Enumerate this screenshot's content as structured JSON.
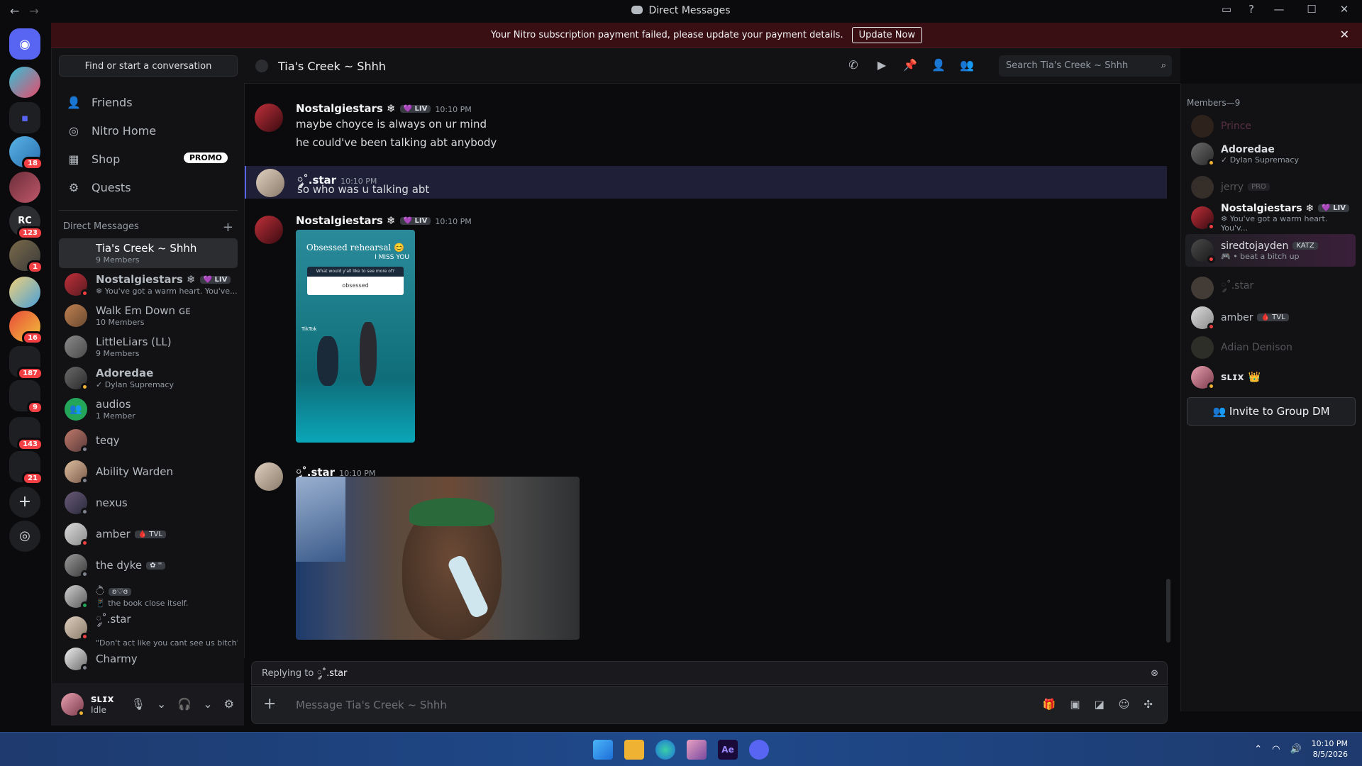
{
  "window": {
    "title": "Direct Messages"
  },
  "banner": {
    "text": "Your Nitro subscription payment failed, please update your payment details.",
    "button": "Update Now"
  },
  "guild_badges": [
    "18",
    "123",
    "1",
    "16",
    "187",
    "9",
    "143",
    "21"
  ],
  "dm_sidebar": {
    "find_placeholder": "Find or start a conversation",
    "nav": [
      {
        "label": "Friends",
        "icon": "friends-icon"
      },
      {
        "label": "Nitro Home",
        "icon": "nitro-icon"
      },
      {
        "label": "Shop",
        "icon": "shop-icon",
        "badge": "PROMO"
      },
      {
        "label": "Quests",
        "icon": "quests-icon"
      }
    ],
    "section_header": "Direct Messages",
    "items": [
      {
        "name": "Tia's Creek ~ Shhh",
        "sub": "9 Members",
        "selected": true
      },
      {
        "name": "Nostalgiestars ❄",
        "tag": "💜 LIV",
        "sub": "❄ You've got a warm heart. You've..."
      },
      {
        "name": "Walk Em Down ɢᴇ",
        "sub": "10 Members"
      },
      {
        "name": "LittleLiars (LL)",
        "sub": "9 Members"
      },
      {
        "name": "Adoredae",
        "sub": "✓ Dylan Supremacy"
      },
      {
        "name": "audios",
        "sub": "1 Member"
      },
      {
        "name": "teqy",
        "sub": ""
      },
      {
        "name": "Ability Warden",
        "sub": ""
      },
      {
        "name": "nexus",
        "sub": ""
      },
      {
        "name": "amber",
        "tag": "🩸 TVL",
        "sub": ""
      },
      {
        "name": "the dyke",
        "tag": "✿ '' ",
        "sub": ""
      },
      {
        "name": "ੈ",
        "tag": "ʚ♡ɞ",
        "sub": "📱 the book close itself."
      },
      {
        "name": "༘˚.star",
        "sub": "\"Don't act like you cant see us bitch\""
      },
      {
        "name": "Charmy",
        "sub": ""
      }
    ]
  },
  "user_panel": {
    "name": "ꜱʟɪx",
    "status": "Idle"
  },
  "chat": {
    "title": "Tia's Creek ~ Shhh",
    "search_placeholder": "Search Tia's Creek ~ Shhh",
    "messages": [
      {
        "author": "Nostalgiestars ❄",
        "tag": "💜 LIV",
        "time": "10:10 PM",
        "lines": [
          "maybe choyce is always on ur mind",
          "he could've been talking abt anybody"
        ]
      },
      {
        "author": "༘˚.star",
        "time": "10:10 PM",
        "lines": [
          "so who was u talking abt"
        ],
        "highlighted": true
      },
      {
        "author": "Nostalgiestars ❄",
        "tag": "💜 LIV",
        "time": "10:10 PM",
        "image": {
          "caption_top": "Obsessed rehearsal 😊",
          "caption_sub": "I MISS YOU",
          "question": "What would y'all like to see more of?",
          "answer": "obsessed",
          "watermark": "TikTok"
        }
      },
      {
        "author": "༘˚.star",
        "time": "10:10 PM",
        "image_kind": "gif"
      }
    ],
    "reply": {
      "prefix": "Replying to",
      "to": "༘˚.star"
    },
    "composer_placeholder": "Message Tia's Creek ~ Shhh"
  },
  "members": {
    "header": "Members—9",
    "items": [
      {
        "name": "Prince",
        "sub": "",
        "dim": true,
        "color": "#c25c8a"
      },
      {
        "name": "Adoredae",
        "sub": "✓ Dylan Supremacy"
      },
      {
        "name": "jerry",
        "tag": "PRO",
        "sub": "",
        "dim": true
      },
      {
        "name": "Nostalgiestars ❄",
        "tag": "💜 LIV",
        "sub": "❄ You've got a warm heart. You'v..."
      },
      {
        "name": "siredtojayden",
        "tag": "KATZ",
        "sub": "🎮 • beat a bitch up"
      },
      {
        "name": "༘˚.star",
        "sub": "",
        "dim": true
      },
      {
        "name": "amber",
        "tag": "🩸 TVL",
        "sub": ""
      },
      {
        "name": "Adian Denison",
        "sub": "",
        "dim": true
      },
      {
        "name": "ꜱʟɪx",
        "tag": "👑",
        "sub": ""
      }
    ],
    "invite_button": "Invite to Group DM"
  },
  "taskbar": {
    "time": "10:10 PM",
    "date": "8/5/2026"
  }
}
